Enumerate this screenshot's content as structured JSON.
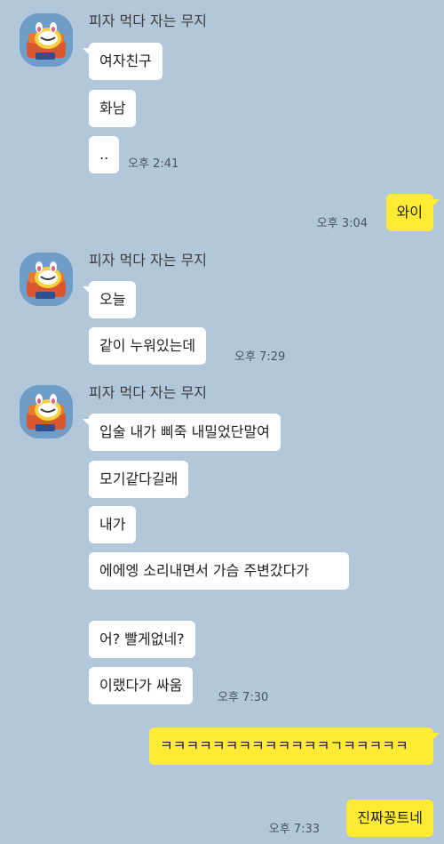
{
  "colors": {
    "background": "#b2c7da",
    "incoming_bubble": "#ffffff",
    "outgoing_bubble": "#ffeb33",
    "avatar_bg": "#6e9ec8"
  },
  "groups": [
    {
      "sender": "피자 먹다 자는 무지",
      "avatar_icon": "muzi-avatar-icon",
      "messages": [
        "여자친구",
        "화남",
        ".."
      ],
      "time": "오후 2:41"
    },
    {
      "sender": "피자 먹다 자는 무지",
      "avatar_icon": "muzi-avatar-icon",
      "messages": [
        "오늘",
        "같이 누워있는데"
      ],
      "time": "오후 7:29"
    },
    {
      "sender": "피자 먹다 자는 무지",
      "avatar_icon": "muzi-avatar-icon",
      "messages": [
        "입술 내가 삐죽 내밀었단말여",
        "모기같다길래",
        "내가",
        "에에엥 소리내면서 가슴 주변갔다가",
        "어? 빨게없네?",
        "이랬다가 싸움"
      ],
      "time": "오후 7:30"
    }
  ],
  "outgoing": [
    {
      "text": "와이",
      "time": "오후 3:04"
    },
    {
      "text": "ㅋㅋㅋㅋㅋㅋㅋㅋㅋㅋㅋㅋㅋㄱㅋㅋㅋㅋㅋ",
      "time": ""
    },
    {
      "text": "진짜꽁트네",
      "time": "오후 7:33"
    }
  ]
}
